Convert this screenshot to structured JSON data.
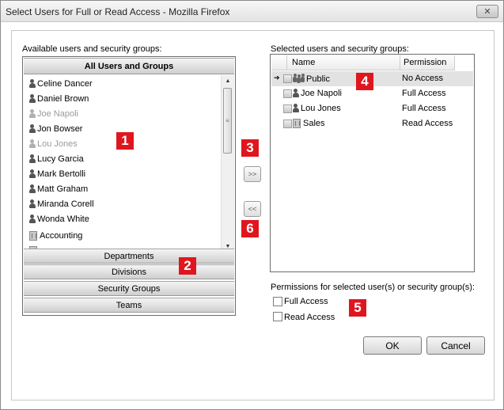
{
  "window": {
    "title": "Select Users for Full or Read Access - Mozilla Firefox"
  },
  "left": {
    "label": "Available users and security groups:",
    "top_header": "All Users and Groups",
    "users": [
      {
        "name": "Celine Dancer",
        "icon": "person-icon",
        "disabled": false
      },
      {
        "name": "Daniel Brown",
        "icon": "person-icon",
        "disabled": false
      },
      {
        "name": "Joe Napoli",
        "icon": "person-icon",
        "disabled": true
      },
      {
        "name": "Jon Bowser",
        "icon": "person-icon",
        "disabled": false
      },
      {
        "name": "Lou Jones",
        "icon": "person-icon",
        "disabled": true
      },
      {
        "name": "Lucy Garcia",
        "icon": "person-icon",
        "disabled": false
      },
      {
        "name": "Mark Bertolli",
        "icon": "person-icon",
        "disabled": false
      },
      {
        "name": "Matt Graham",
        "icon": "person-icon",
        "disabled": false
      },
      {
        "name": "Miranda Corell",
        "icon": "person-icon",
        "disabled": false
      },
      {
        "name": "Wonda White",
        "icon": "person-icon",
        "disabled": false
      },
      {
        "name": "Accounting",
        "icon": "building-icon",
        "disabled": false
      }
    ],
    "sections": [
      "Departments",
      "Divisions",
      "Security Groups",
      "Teams"
    ]
  },
  "middle": {
    "add_label": ">>",
    "remove_label": "<<"
  },
  "right": {
    "label": "Selected users and security groups:",
    "columns": [
      "Name",
      "Permission"
    ],
    "rows": [
      {
        "name": "Public",
        "permission": "No Access",
        "icon": "group-icon",
        "selected": true
      },
      {
        "name": "Joe Napoli",
        "permission": "Full Access",
        "icon": "person-icon",
        "selected": false
      },
      {
        "name": "Lou Jones",
        "permission": "Full Access",
        "icon": "person-icon",
        "selected": false
      },
      {
        "name": "Sales",
        "permission": "Read Access",
        "icon": "building-icon",
        "selected": false
      }
    ],
    "perm_label": "Permissions for selected user(s) or security group(s):",
    "full_access": "Full Access",
    "read_access": "Read Access"
  },
  "buttons": {
    "ok": "OK",
    "cancel": "Cancel"
  },
  "badges": {
    "b1": "1",
    "b2": "2",
    "b3": "3",
    "b4": "4",
    "b5": "5",
    "b6": "6"
  },
  "colors": {
    "badge": "#e0161e",
    "selected_row": "#e2e2e2"
  }
}
